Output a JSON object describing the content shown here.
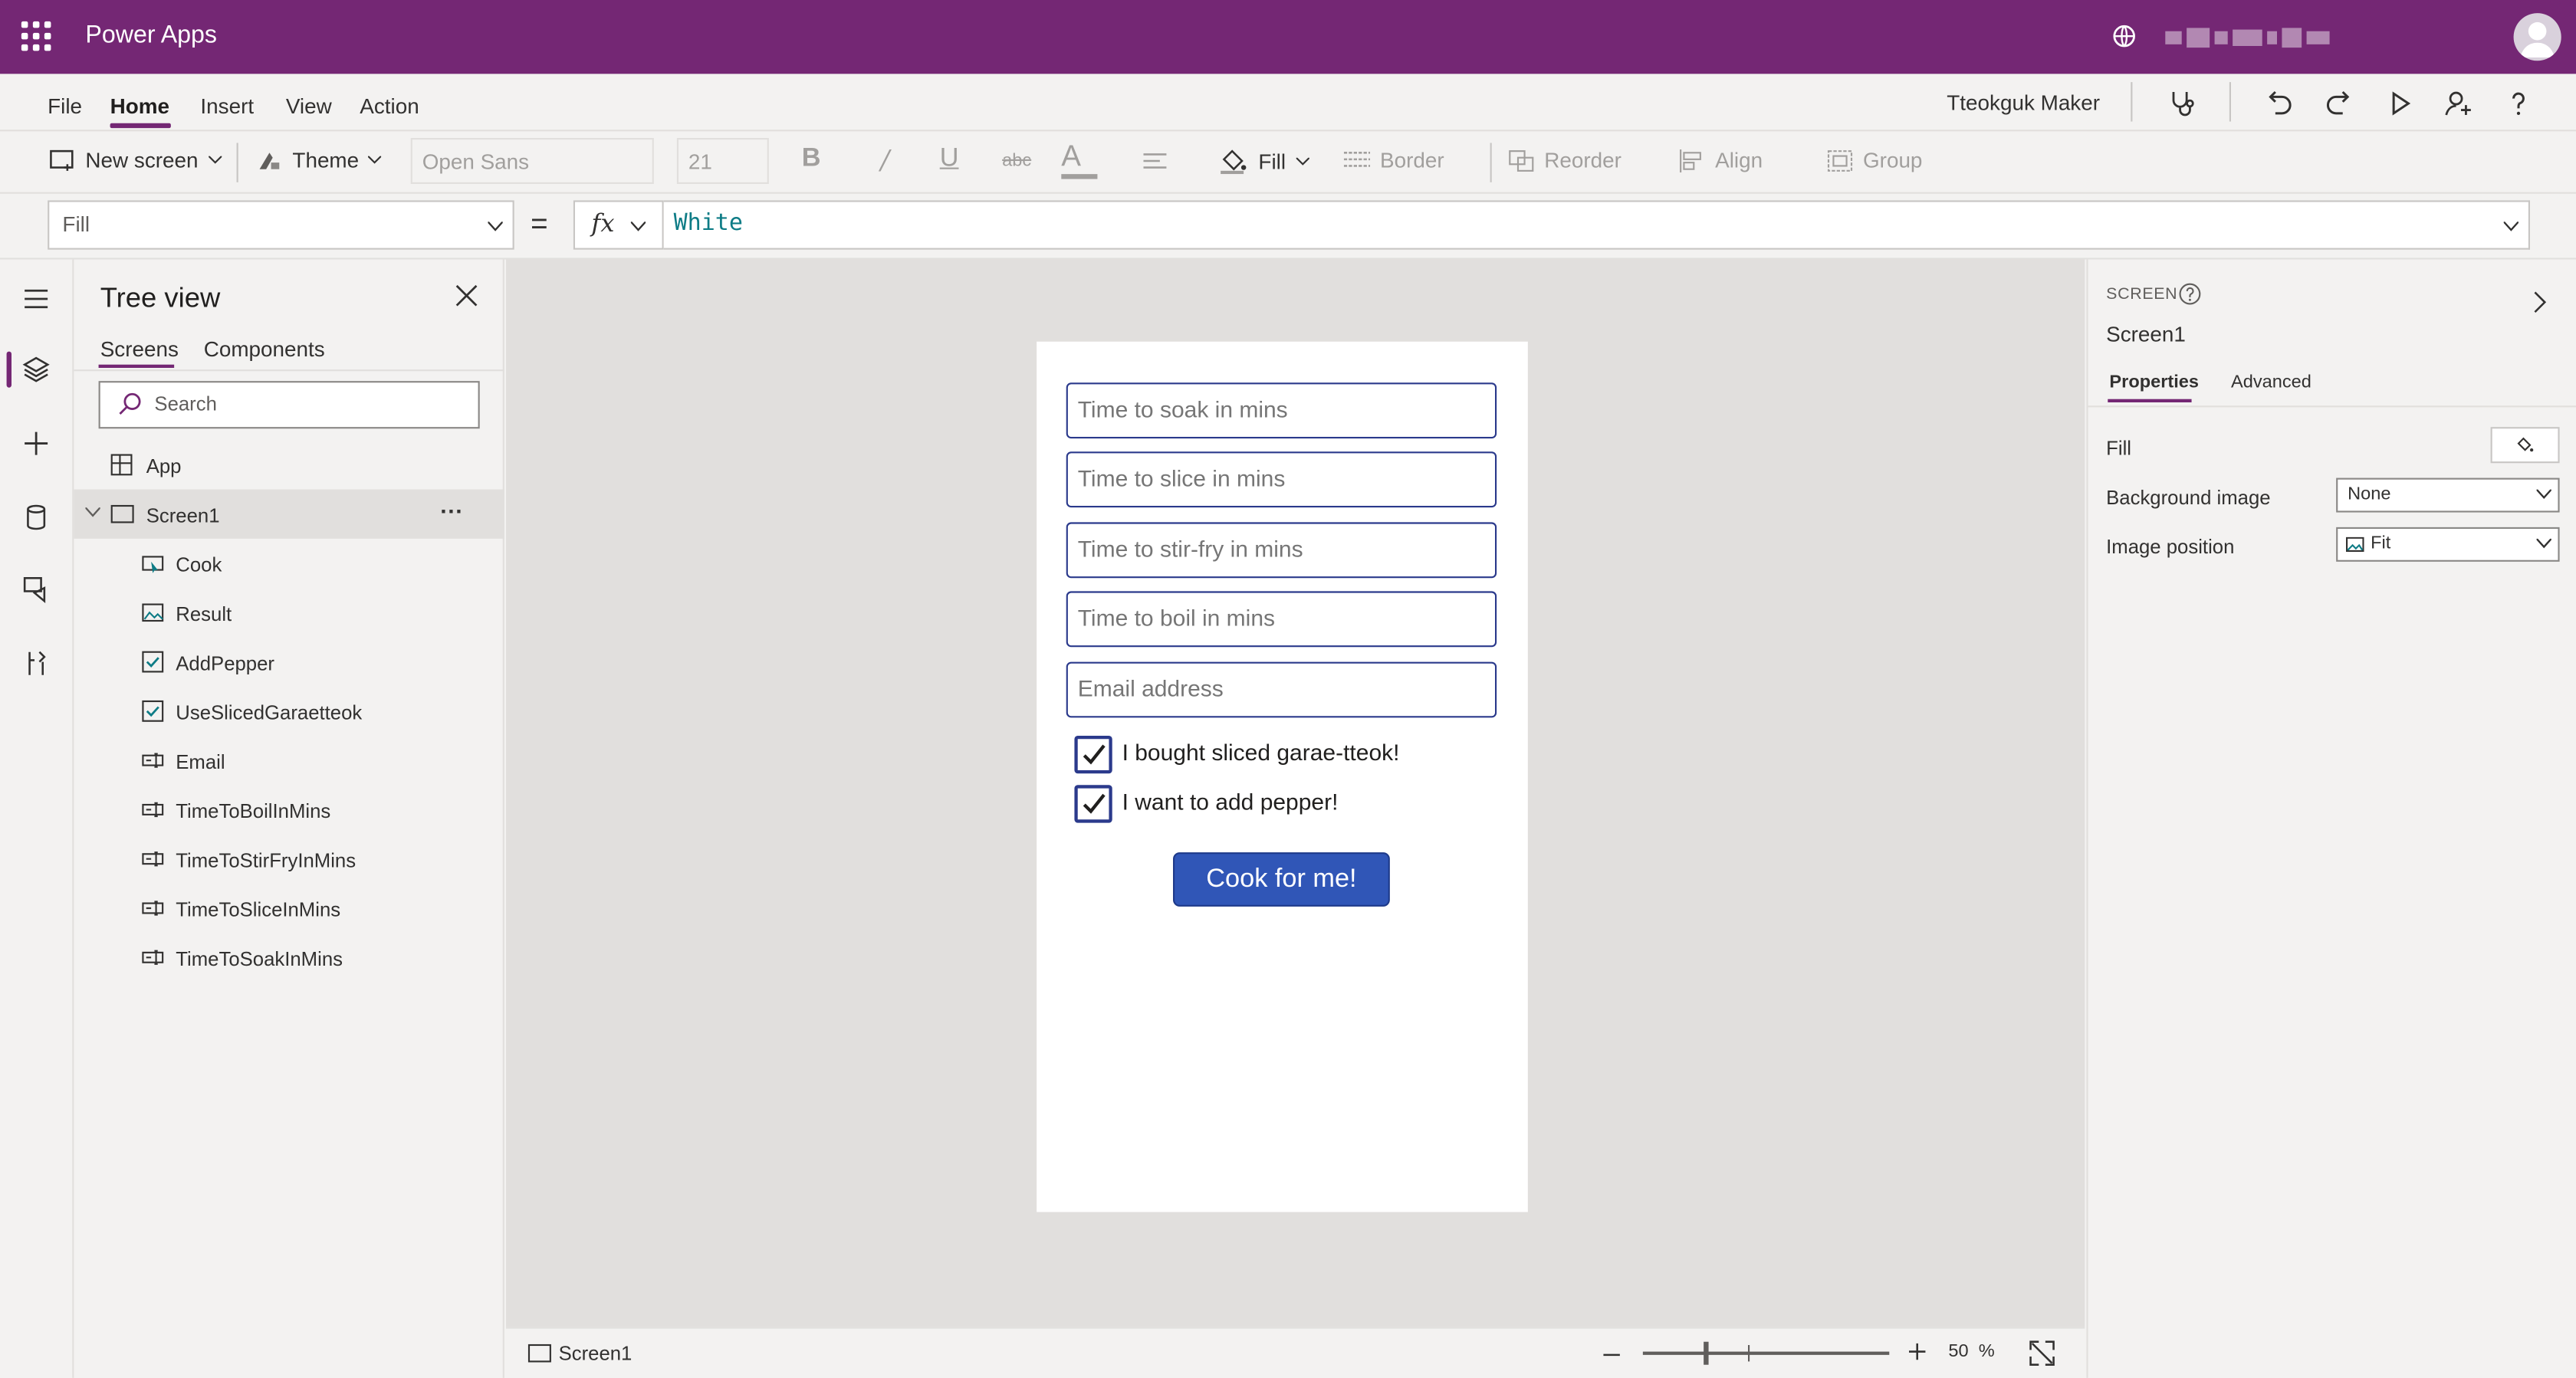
{
  "app": {
    "title": "Power Apps"
  },
  "menu": {
    "items": [
      "File",
      "Home",
      "Insert",
      "View",
      "Action"
    ],
    "active": "Home",
    "maker_name": "Tteokguk Maker"
  },
  "ribbon": {
    "new_screen": "New screen",
    "theme": "Theme",
    "font": "Open Sans",
    "font_size": "21",
    "fill": "Fill",
    "border": "Border",
    "reorder": "Reorder",
    "align": "Align",
    "group": "Group"
  },
  "formula": {
    "property": "Fill",
    "equals": "=",
    "fx": "fx",
    "value": "White"
  },
  "tree": {
    "title": "Tree view",
    "tabs": [
      "Screens",
      "Components"
    ],
    "active_tab": "Screens",
    "search_placeholder": "Search",
    "app_node": "App",
    "screen_node": "Screen1",
    "more": "···",
    "children": [
      {
        "label": "Cook",
        "icon": "button-icon"
      },
      {
        "label": "Result",
        "icon": "image-icon"
      },
      {
        "label": "AddPepper",
        "icon": "checkbox-icon"
      },
      {
        "label": "UseSlicedGaraetteok",
        "icon": "checkbox-icon"
      },
      {
        "label": "Email",
        "icon": "textinput-icon"
      },
      {
        "label": "TimeToBoilInMins",
        "icon": "textinput-icon"
      },
      {
        "label": "TimeToStirFryInMins",
        "icon": "textinput-icon"
      },
      {
        "label": "TimeToSliceInMins",
        "icon": "textinput-icon"
      },
      {
        "label": "TimeToSoakInMins",
        "icon": "textinput-icon"
      }
    ]
  },
  "canvas": {
    "inputs": [
      "Time to soak in mins",
      "Time to slice in mins",
      "Time to stir-fry in mins",
      "Time to boil in mins",
      "Email address"
    ],
    "checkboxes": [
      {
        "label": "I bought sliced garae-tteok!",
        "checked": true
      },
      {
        "label": "I want to add pepper!",
        "checked": true
      }
    ],
    "button": "Cook for me!"
  },
  "status": {
    "screen": "Screen1",
    "zoom": "50",
    "zoom_unit": "%"
  },
  "props": {
    "kind": "SCREEN",
    "name": "Screen1",
    "tabs": [
      "Properties",
      "Advanced"
    ],
    "active_tab": "Properties",
    "rows": [
      {
        "label": "Fill",
        "value": ""
      },
      {
        "label": "Background image",
        "value": "None"
      },
      {
        "label": "Image position",
        "value": "Fit"
      }
    ]
  },
  "colors": {
    "brand": "#742774",
    "input_border": "#2b3a8c",
    "button": "#3056b7",
    "formula_text": "#0e7c86"
  }
}
